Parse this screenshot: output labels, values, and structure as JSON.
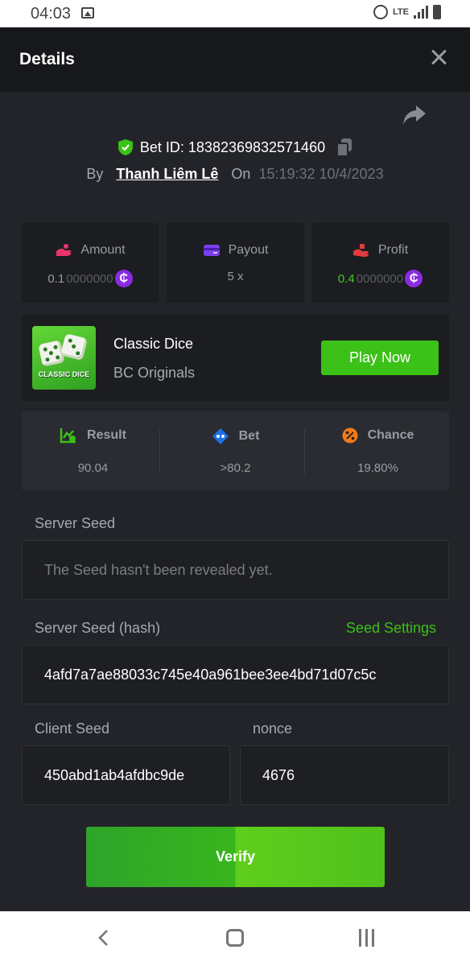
{
  "status_bar": {
    "time": "04:03",
    "network": "LTE"
  },
  "header": {
    "title": "Details"
  },
  "bet": {
    "id_text": "Bet ID: 18382369832571460",
    "by_label": "By",
    "user": "Thanh Liêm Lê",
    "on_label": "On",
    "datetime": "15:19:32 10/4/2023"
  },
  "stats": {
    "amount_label": "Amount",
    "amount_main": "0.1",
    "amount_dim": "0000000",
    "payout_label": "Payout",
    "payout_value": "5 x",
    "profit_label": "Profit",
    "profit_main": "0.4",
    "profit_dim": "0000000",
    "currency_symbol": "₵"
  },
  "game": {
    "thumb_label": "CLASSIC DICE",
    "name": "Classic Dice",
    "provider": "BC Originals",
    "play_label": "Play Now"
  },
  "result": {
    "result_label": "Result",
    "result_value": "90.04",
    "bet_label": "Bet",
    "bet_value": ">80.2",
    "chance_label": "Chance",
    "chance_value": "19.80%"
  },
  "seeds": {
    "server_seed_label": "Server Seed",
    "server_seed_placeholder": "The Seed hasn't been revealed yet.",
    "server_hash_label": "Server Seed (hash)",
    "seed_settings_label": "Seed Settings",
    "server_hash_value": "4afd7a7ae88033c745e40a961bee3ee4bd71d07c5c",
    "client_seed_label": "Client Seed",
    "client_seed_value": "450abd1ab4afdbc9de",
    "nonce_label": "nonce",
    "nonce_value": "4676"
  },
  "verify_label": "Verify",
  "colors": {
    "accent_green": "#3bc117",
    "coin_purple": "#8a2be2",
    "background": "#232429"
  }
}
